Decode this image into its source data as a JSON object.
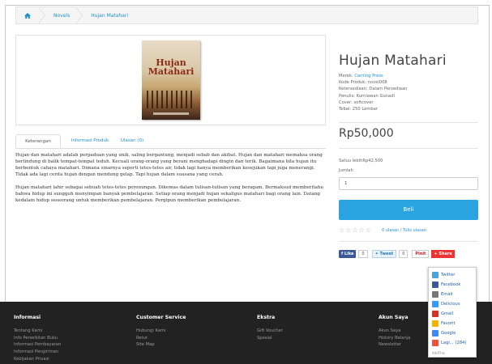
{
  "breadcrumb": {
    "home_icon": "home-icon",
    "items": [
      "Novels",
      "Hujan Matahari"
    ]
  },
  "product_image": {
    "cover_title_line1": "Hujan",
    "cover_title_line2": "Matahari"
  },
  "tabs": [
    "Keterangan",
    "Informasi Produk",
    "Ulasan (0)"
  ],
  "description": [
    "Hujan dan matahari adalah perpaduan yang unik, saling bergantung, menjadi sebab dan akibat. Hujan dan matahari memaksa orang berlindung di balik tempat-tempat teduh. Kecuali orang-orang yang berani menghadapi dingin dan terik. Bagaimana bila hujan itu berbentuk cahaya matahari. Dimana sinarnya seperti tetes-tetes air, tidak lagi hanya memberikan kesejukan tapi juga menerangi. Tidak ada lagi cerita hujan dengan mendung gelap. Tapi hujan dalam suasana yang cerah.",
    "Hujan matahari lahir sebagai sebuah tetes-tetes perenungan. Dikemas dalam tulisan-tulisan yang beragam. Bermaksud memberitahu bahwa hidup ini sungguh menyimpan banyak pembelajaran. Setiap orang menjadi hujan sekaligus matahari bagi orang lain. Datang kedalam hidup seseorang untuk memberikan pembelajaran. Pergipun memberikan pembelajaran."
  ],
  "product": {
    "title": "Hujan Matahari",
    "specs": [
      {
        "label": "Merek: ",
        "value": "Canting Press",
        "link": true
      },
      {
        "label": "Kode Produk: ",
        "value": "novel008",
        "link": false
      },
      {
        "label": "Ketersediaan: ",
        "value": "Dalam Persediaan",
        "link": false
      },
      {
        "label": "Penulis: ",
        "value": "Kurniawan Gunadi",
        "link": false
      },
      {
        "label": "Cover: ",
        "value": "softcover",
        "link": false
      },
      {
        "label": "Tebal: ",
        "value": "250 Lembar",
        "link": false
      }
    ],
    "price": "Rp50,000",
    "discount": "Satuu lebihRp42,500",
    "qty_label": "Jumlah",
    "qty_value": "1",
    "buy_label": "Beli",
    "rating_stars": 0,
    "review_links": "0 ulasan / Tulis ulasan"
  },
  "share_bar": {
    "like_label": "Like",
    "like_count": "0",
    "tweet_label": "Tweet",
    "tweet_count": "0",
    "pin_label": "Pinit",
    "share_label": "Share"
  },
  "share_popup": {
    "items": [
      {
        "label": "Twitter",
        "color": "#4aa3df"
      },
      {
        "label": "Facebook",
        "color": "#3b5998"
      },
      {
        "label": "Email",
        "color": "#777777"
      },
      {
        "label": "Delicious",
        "color": "#3399ff"
      },
      {
        "label": "Gmail",
        "color": "#d93025"
      },
      {
        "label": "Favorit",
        "color": "#f0b400"
      },
      {
        "label": "Google",
        "color": "#4285f4"
      },
      {
        "label": "Lagi... (284)",
        "color": "#e8533b"
      }
    ],
    "footer": "AddThis"
  },
  "footer": {
    "columns": [
      {
        "heading": "Informasi",
        "items": [
          "Tentang Kami",
          "Info Penerbitan Buku",
          "Informasi Pembayaran",
          "Informasi Pengiriman",
          "Kebijakan Privasi"
        ]
      },
      {
        "heading": "Customer Service",
        "items": [
          "Hubungi Kami",
          "Retur",
          "Site Map"
        ]
      },
      {
        "heading": "Ekstra",
        "items": [
          "Gift Voucher",
          "Spesial"
        ]
      },
      {
        "heading": "Akun Saya",
        "items": [
          "Akun Saya",
          "History Belanja",
          "Newsletter"
        ]
      }
    ]
  },
  "colors": {
    "link": "#1e91cf",
    "buy_button": "#2aa4e0",
    "footer_bg": "#222222"
  }
}
